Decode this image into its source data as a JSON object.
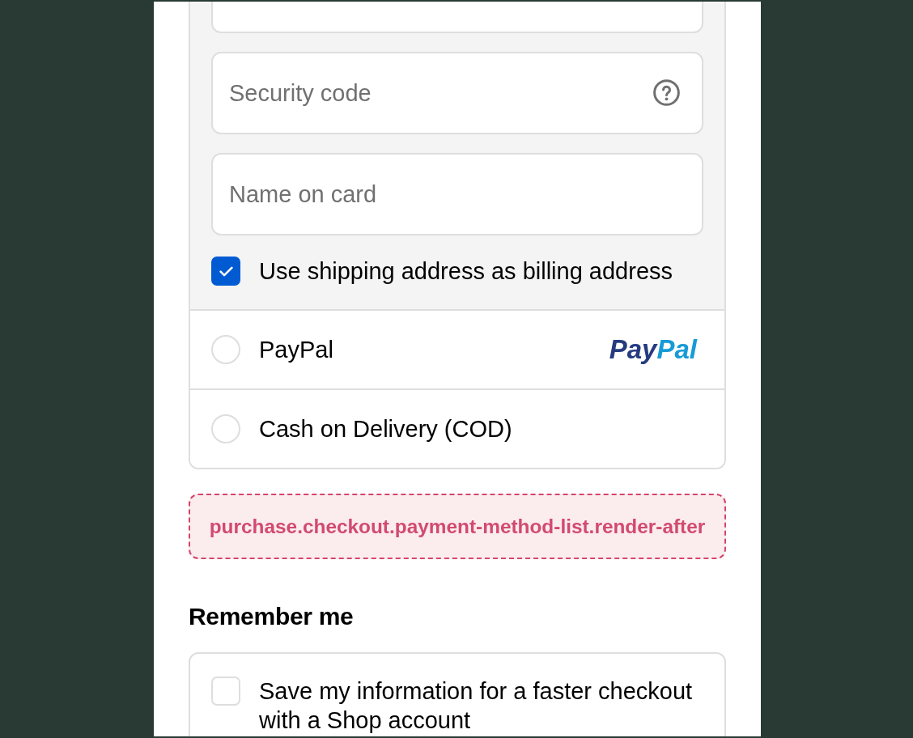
{
  "payment": {
    "card_form": {
      "fields": [
        {
          "help_icon": false
        },
        {
          "placeholder": "Security code",
          "help_icon": true
        },
        {
          "placeholder": "Name on card",
          "help_icon": false
        }
      ],
      "billing_checkbox": {
        "label": "Use shipping address as billing address",
        "checked": true
      }
    },
    "methods": [
      {
        "label": "PayPal",
        "selected": false,
        "logo": [
          {
            "text": "Pay",
            "color": "#253b80"
          },
          {
            "text": "Pal",
            "color": "#179bd7"
          }
        ]
      },
      {
        "label": "Cash on Delivery (COD)",
        "selected": false
      }
    ]
  },
  "extension_target": {
    "label": "purchase.checkout.payment-method-list.render-after"
  },
  "remember_me": {
    "heading": "Remember me",
    "checkbox": {
      "label": "Save my information for a faster checkout with a Shop account",
      "checked": false
    }
  }
}
